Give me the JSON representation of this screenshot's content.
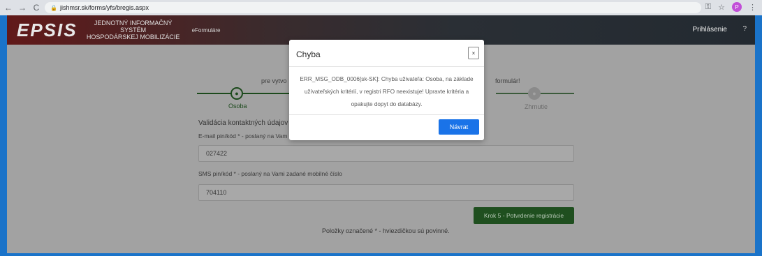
{
  "browser": {
    "url": "jishmsr.sk/forms/yfs/bregis.aspx"
  },
  "header": {
    "logo": "EPSIS",
    "logo_line1": "JEDNOTNÝ INFORMAČNÝ SYSTÉM",
    "logo_line2": "HOSPODÁRSKEJ MOBILIZÁCIE",
    "eforms": "eFormuláre",
    "login": "Prihlásenie",
    "help": "?"
  },
  "page": {
    "intro_left": "pre vytvo",
    "intro_right": "formulár!",
    "steps": [
      {
        "label": "Osoba",
        "icon": "person-icon"
      },
      {
        "label": "Zhrnutie",
        "icon": "person-icon"
      }
    ],
    "section_title": "Validácia kontaktných údajov",
    "email_label": "E-mail pin/kód * - poslaný na Vam",
    "email_value": "027422",
    "sms_label": "SMS pin/kód * - poslaný na Vami zadané mobilné číslo",
    "sms_value": "704110",
    "step_button": "Krok 5 - Potvrdenie registrácie",
    "footnote": "Položky označené * - hviezdičkou sú povinné."
  },
  "modal": {
    "title": "Chyba",
    "close": "×",
    "body": "ERR_MSG_ODB_0006[sk-SK]: Chyba uživateľa: Osoba, na základe užívateľských kritérií, v registri RFO neexistuje! Upravte kritéria a opakujte dopyt do databázy.",
    "button": "Návrat"
  }
}
